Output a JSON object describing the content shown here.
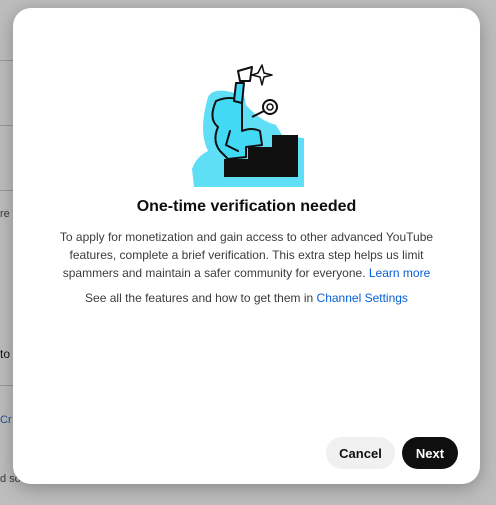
{
  "background": {
    "fragments": [
      "re a",
      "to",
      "Cr",
      "d so"
    ]
  },
  "dialog": {
    "illustration_icon": "verification-stairs-illustration",
    "title": "One-time verification needed",
    "body_text": "To apply for monetization and gain access to other advanced YouTube features, complete a brief verification. This extra step helps us limit spammers and maintain a safer community for everyone. ",
    "learn_more": "Learn more",
    "settings_prefix": "See all the features and how to get them in ",
    "settings_link": "Channel Settings",
    "cancel_label": "Cancel",
    "next_label": "Next"
  },
  "colors": {
    "accent_cyan": "#42d9f5",
    "link_blue": "#065fd4",
    "primary_button": "#0f0f0f",
    "secondary_button": "#f0f0f0"
  }
}
